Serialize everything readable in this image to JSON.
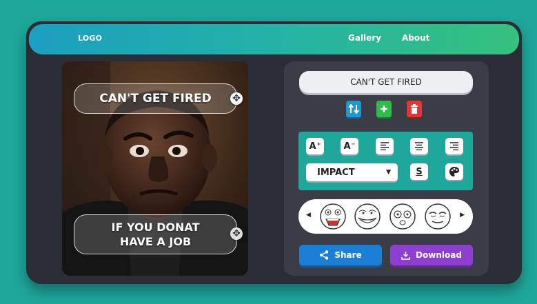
{
  "nav": {
    "logo": "LOGO",
    "links": [
      "Gallery",
      "About"
    ]
  },
  "meme": {
    "top_text": "CAN'T GET FIRED",
    "bottom_line1": "IF YOU DONAT",
    "bottom_line2": "HAVE A JOB"
  },
  "controls": {
    "text_value": "CAN'T GET FIRED",
    "font_select": "IMPACT",
    "underline_label": "S",
    "increase_font": "A",
    "decrease_font": "A",
    "share_label": "Share",
    "download_label": "Download"
  },
  "icons": {
    "swap": "swap-vertical-icon",
    "add": "plus-icon",
    "delete": "trash-icon",
    "align_left": "align-left-icon",
    "align_center": "align-center-icon",
    "align_right": "align-right-icon",
    "palette": "palette-icon",
    "share": "share-icon",
    "download": "download-icon"
  },
  "colors": {
    "background": "#1fa79b",
    "app": "#2a2d35",
    "panel": "#3a3d45",
    "nav_gradient_start": "#1c9fc0",
    "nav_gradient_end": "#35c27d",
    "swap_button": "#2196d3",
    "add_button": "#2ebd4b",
    "delete_button": "#e13737",
    "share_button": "#1c7fd6",
    "download_button": "#8e3fcf"
  }
}
